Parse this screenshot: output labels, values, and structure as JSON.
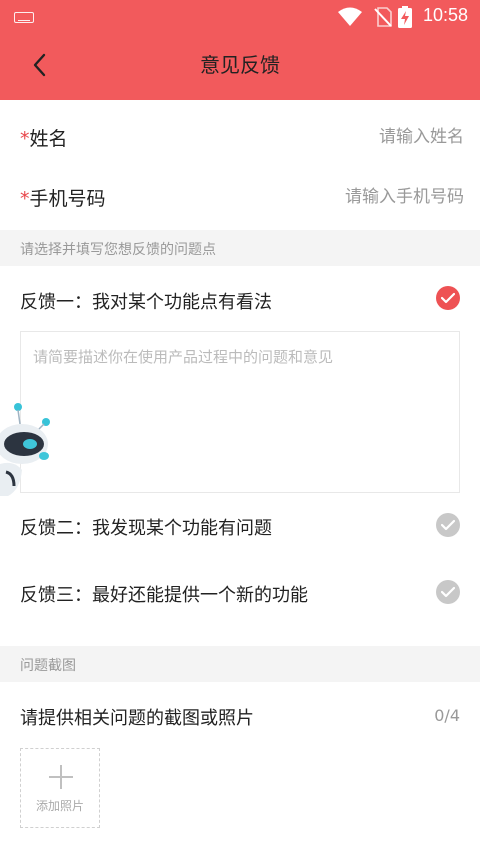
{
  "status_bar": {
    "time": "10:58"
  },
  "header": {
    "title": "意见反馈",
    "accent_color": "#F25A5C"
  },
  "form": {
    "name": {
      "required_mark": "*",
      "label": "姓名",
      "placeholder": "请输入姓名"
    },
    "phone": {
      "required_mark": "*",
      "label": "手机号码",
      "placeholder": "请输入手机号码"
    }
  },
  "feedback_section": {
    "header": "请选择并填写您想反馈的问题点",
    "options": [
      {
        "label": "反馈一：我对某个功能点有看法",
        "selected": true
      },
      {
        "label": "反馈二：我发现某个功能有问题",
        "selected": false
      },
      {
        "label": "反馈三：最好还能提供一个新的功能",
        "selected": false
      }
    ],
    "textarea_placeholder": "请简要描述你在使用产品过程中的问题和意见"
  },
  "screenshot_section": {
    "header": "问题截图",
    "prompt": "请提供相关问题的截图或照片",
    "counter": "0/4",
    "add_photo_label": "添加照片"
  }
}
